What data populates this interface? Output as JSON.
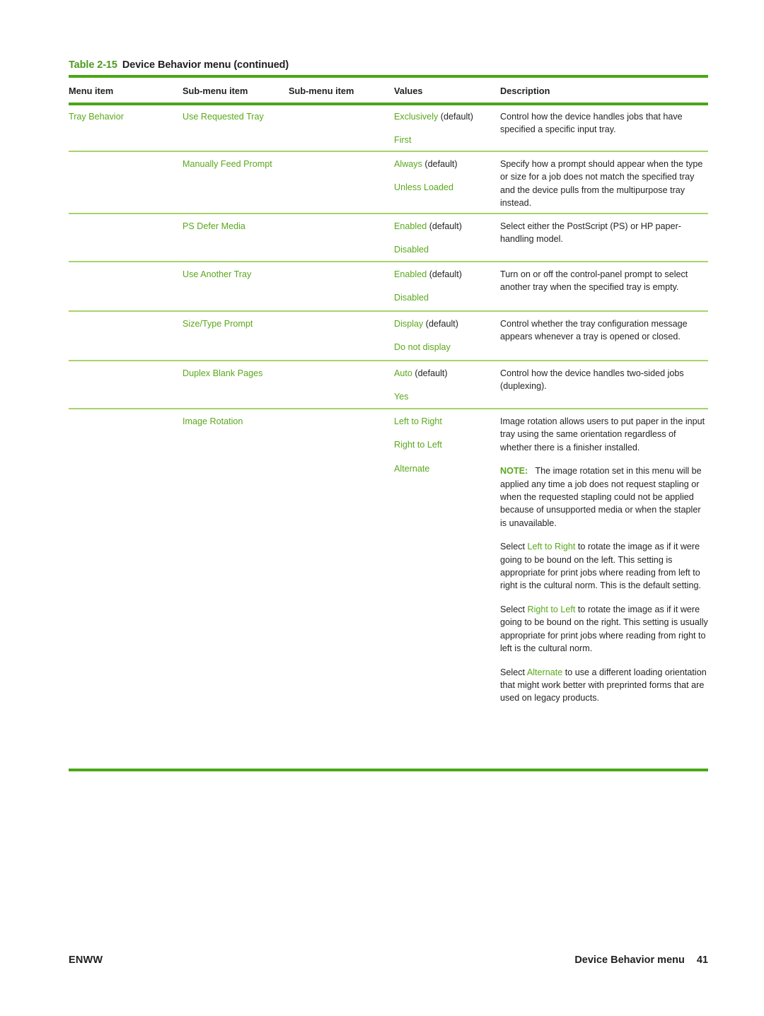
{
  "document": {
    "table_caption_number": "Table 2-15",
    "table_caption_title": "Device Behavior menu (continued)",
    "accent_green": "#5aa81c",
    "rule_heavy_green": "#4ba617",
    "rule_light_green": "#a7d46a"
  },
  "table": {
    "headers": {
      "menu_item": "Menu item",
      "sub_menu_item_1": "Sub-menu item",
      "sub_menu_item_2": "Sub-menu item",
      "values": "Values",
      "description": "Description"
    },
    "rows": [
      {
        "menu_item": "Tray Behavior",
        "sub_menu_1": "Use Requested Tray",
        "sub_menu_2": "",
        "value_1": "Exclusively",
        "value_1_default": "(default)",
        "value_2": "First",
        "desc_1": "Control how the device handles jobs that have specified a specific input tray."
      },
      {
        "menu_item": "",
        "sub_menu_1": "Manually Feed Prompt",
        "sub_menu_2": "",
        "value_1": "Always",
        "value_1_default": "(default)",
        "value_2": "Unless Loaded",
        "desc_1": "Specify how a prompt should appear when the type or size for a job does not match the specified tray and the device pulls from the multipurpose tray instead."
      },
      {
        "menu_item": "",
        "sub_menu_1": "PS Defer Media",
        "sub_menu_2": "",
        "value_1": "Enabled",
        "value_1_default": "(default)",
        "value_2": "Disabled",
        "desc_1": "Select either the PostScript (PS) or HP paper-handling model."
      },
      {
        "menu_item": "",
        "sub_menu_1": "Use Another Tray",
        "sub_menu_2": "",
        "value_1": "Enabled",
        "value_1_default": "(default)",
        "value_2": "Disabled",
        "desc_1": "Turn on or off the control-panel prompt to select another tray when the specified tray is empty."
      },
      {
        "menu_item": "",
        "sub_menu_1": "Size/Type Prompt",
        "sub_menu_2": "",
        "value_1": "Display",
        "value_1_default": "(default)",
        "value_2": "Do not display",
        "desc_1": "Control whether the tray configuration message appears whenever a tray is opened or closed."
      },
      {
        "menu_item": "",
        "sub_menu_1": "Duplex Blank Pages",
        "sub_menu_2": "",
        "value_1": "Auto",
        "value_1_default": "(default)",
        "value_2": "Yes",
        "desc_1": "Control how the device handles two-sided jobs (duplexing)."
      }
    ],
    "image_rotation_row": {
      "menu_item": "",
      "sub_menu_1": "Image Rotation",
      "values": [
        "Left to Right",
        "Right to Left",
        "Alternate"
      ],
      "desc_intro": "Image rotation allows users to put paper in the input tray using the same orientation regardless of whether there is a finisher installed.",
      "note_label": "NOTE:",
      "note_body": "The image rotation set in this menu will be applied any time a job does not request stapling or when the requested stapling could not be applied because of unsupported media or when the stapler is unavailable.",
      "para_ltr_pre": "Select ",
      "para_ltr_term": "Left to Right",
      "para_ltr_post": " to rotate the image as if it were going to be bound on the left. This setting is appropriate for print jobs where reading from left to right is the cultural norm. This is the default setting.",
      "para_rtl_pre": "Select ",
      "para_rtl_term": "Right to Left",
      "para_rtl_post": " to rotate the image as if it were going to be bound on the right. This setting is usually appropriate for print jobs where reading from right to left is the cultural norm.",
      "para_alt_pre": "Select ",
      "para_alt_term": "Alternate",
      "para_alt_post": " to use a different loading orientation that might work better with preprinted forms that are used on legacy products."
    }
  },
  "footer": {
    "left": "ENWW",
    "chapter": "Device Behavior menu",
    "page_number": "41"
  }
}
